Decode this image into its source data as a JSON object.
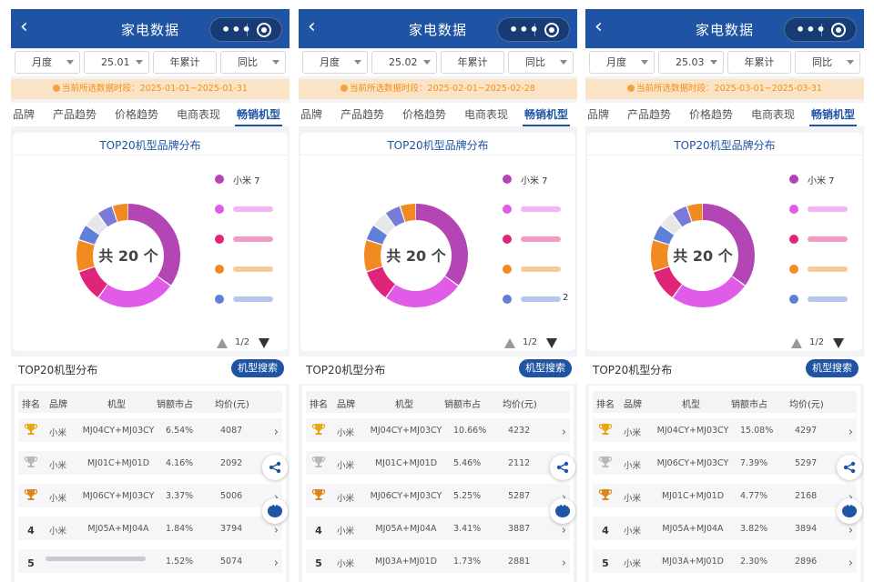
{
  "header": {
    "title": "家电数据"
  },
  "filters": {
    "period": "月度",
    "cumulative": "年累计",
    "compare": "同比"
  },
  "tabs": [
    "品牌",
    "产品趋势",
    "价格趋势",
    "电商表现",
    "畅销机型"
  ],
  "chart_title": "TOP20机型品牌分布",
  "legend_first": "小米 7",
  "pager": "1/2",
  "section2": {
    "title": "TOP20机型分布",
    "search": "机型搜索"
  },
  "table_headers": [
    "排名",
    "品牌",
    "机型",
    "销额市占",
    "均价(元)"
  ],
  "colors": [
    "#b445b4",
    "#e05ce8",
    "#e0247a",
    "#f28a22",
    "#5f7fd8",
    "#e7e7ea",
    "#7a7ad8"
  ],
  "panels": [
    {
      "month": "25.01",
      "notice": "当前所选数据时段：2025-01-01~2025-01-31",
      "center": "共 20 个",
      "legend_extra": "",
      "rows": [
        {
          "rank": "1",
          "brand": "小米",
          "model": "MJ04CY+MJ03CY",
          "share": "6.54%",
          "price": "4087"
        },
        {
          "rank": "2",
          "brand": "小米",
          "model": "MJ01C+MJ01D",
          "share": "4.16%",
          "price": "2092"
        },
        {
          "rank": "3",
          "brand": "小米",
          "model": "MJ06CY+MJ03CY",
          "share": "3.37%",
          "price": "5006"
        },
        {
          "rank": "4",
          "brand": "小米",
          "model": "MJ05A+MJ04A",
          "share": "1.84%",
          "price": "3794"
        },
        {
          "rank": "5",
          "brand": "",
          "model": "",
          "share": "1.52%",
          "price": "5074"
        }
      ]
    },
    {
      "month": "25.02",
      "notice": "当前所选数据时段：2025-02-01~2025-02-28",
      "center": "共 20 个",
      "legend_extra": "2",
      "rows": [
        {
          "rank": "1",
          "brand": "小米",
          "model": "MJ04CY+MJ03CY",
          "share": "10.66%",
          "price": "4232"
        },
        {
          "rank": "2",
          "brand": "小米",
          "model": "MJ01C+MJ01D",
          "share": "5.46%",
          "price": "2112"
        },
        {
          "rank": "3",
          "brand": "小米",
          "model": "MJ06CY+MJ03CY",
          "share": "5.25%",
          "price": "5287"
        },
        {
          "rank": "4",
          "brand": "小米",
          "model": "MJ05A+MJ04A",
          "share": "3.41%",
          "price": "3887"
        },
        {
          "rank": "5",
          "brand": "小米",
          "model": "MJ03A+MJ01D",
          "share": "1.73%",
          "price": "2881"
        }
      ]
    },
    {
      "month": "25.03",
      "notice": "当前所选数据时段：2025-03-01~2025-03-31",
      "center": "共 20 个",
      "legend_extra": "",
      "rows": [
        {
          "rank": "1",
          "brand": "小米",
          "model": "MJ04CY+MJ03CY",
          "share": "15.08%",
          "price": "4297"
        },
        {
          "rank": "2",
          "brand": "小米",
          "model": "MJ06CY+MJ03CY",
          "share": "7.39%",
          "price": "5297"
        },
        {
          "rank": "3",
          "brand": "小米",
          "model": "MJ01C+MJ01D",
          "share": "4.77%",
          "price": "2168"
        },
        {
          "rank": "4",
          "brand": "小米",
          "model": "MJ05A+MJ04A",
          "share": "3.82%",
          "price": "3894"
        },
        {
          "rank": "5",
          "brand": "小米",
          "model": "MJ03A+MJ01D",
          "share": "2.30%",
          "price": "2896"
        }
      ]
    }
  ],
  "chart_data": [
    {
      "type": "pie",
      "title": "TOP20机型品牌分布",
      "legend": [
        "小米 7"
      ],
      "values": [
        7,
        5,
        2,
        2,
        1,
        1,
        1,
        1
      ]
    },
    {
      "type": "pie",
      "title": "TOP20机型品牌分布",
      "legend": [
        "小米 7"
      ],
      "values": [
        7,
        5,
        2,
        2,
        1,
        1,
        1,
        1
      ]
    },
    {
      "type": "pie",
      "title": "TOP20机型品牌分布",
      "legend": [
        "小米 7"
      ],
      "values": [
        7,
        5,
        2,
        2,
        1,
        1,
        1,
        1
      ]
    }
  ]
}
